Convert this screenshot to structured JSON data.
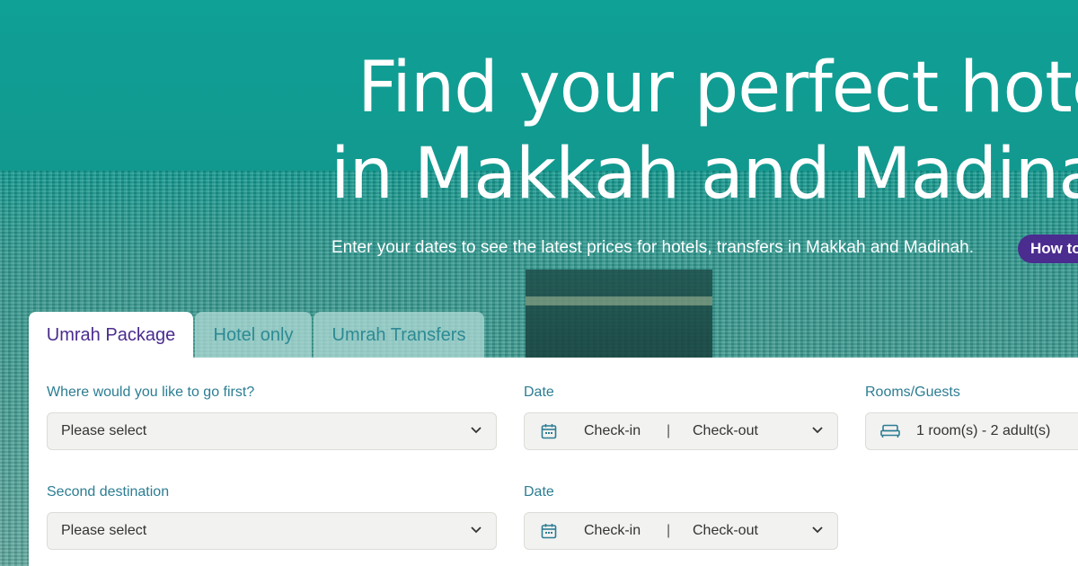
{
  "hero": {
    "title_line1": "Find your perfect hote",
    "title_line2": "in Makkah and Madina",
    "subtitle": "Enter your dates to see the latest prices for hotels, transfers in Makkah and Madinah.",
    "how_to_button": "How to"
  },
  "tabs": [
    {
      "label": "Umrah Package",
      "active": true
    },
    {
      "label": "Hotel only",
      "active": false
    },
    {
      "label": "Umrah Transfers",
      "active": false
    }
  ],
  "form": {
    "first_destination": {
      "label": "Where would you like to go first?",
      "value": "Please select"
    },
    "first_date": {
      "label": "Date",
      "checkin": "Check-in",
      "separator": "|",
      "checkout": "Check-out"
    },
    "rooms": {
      "label": "Rooms/Guests",
      "value": "1 room(s) - 2 adult(s)"
    },
    "second_destination": {
      "label": "Second destination",
      "value": "Please select"
    },
    "second_date": {
      "label": "Date",
      "checkin": "Check-in",
      "separator": "|",
      "checkout": "Check-out"
    }
  },
  "icons": {
    "calendar": "calendar-icon",
    "chevron": "chevron-down-icon",
    "bed": "bed-icon"
  },
  "colors": {
    "brand_teal": "#0f9b91",
    "brand_purple": "#4b2c8f",
    "label_blue": "#2c7d93",
    "field_bg": "#f2f2f0"
  }
}
